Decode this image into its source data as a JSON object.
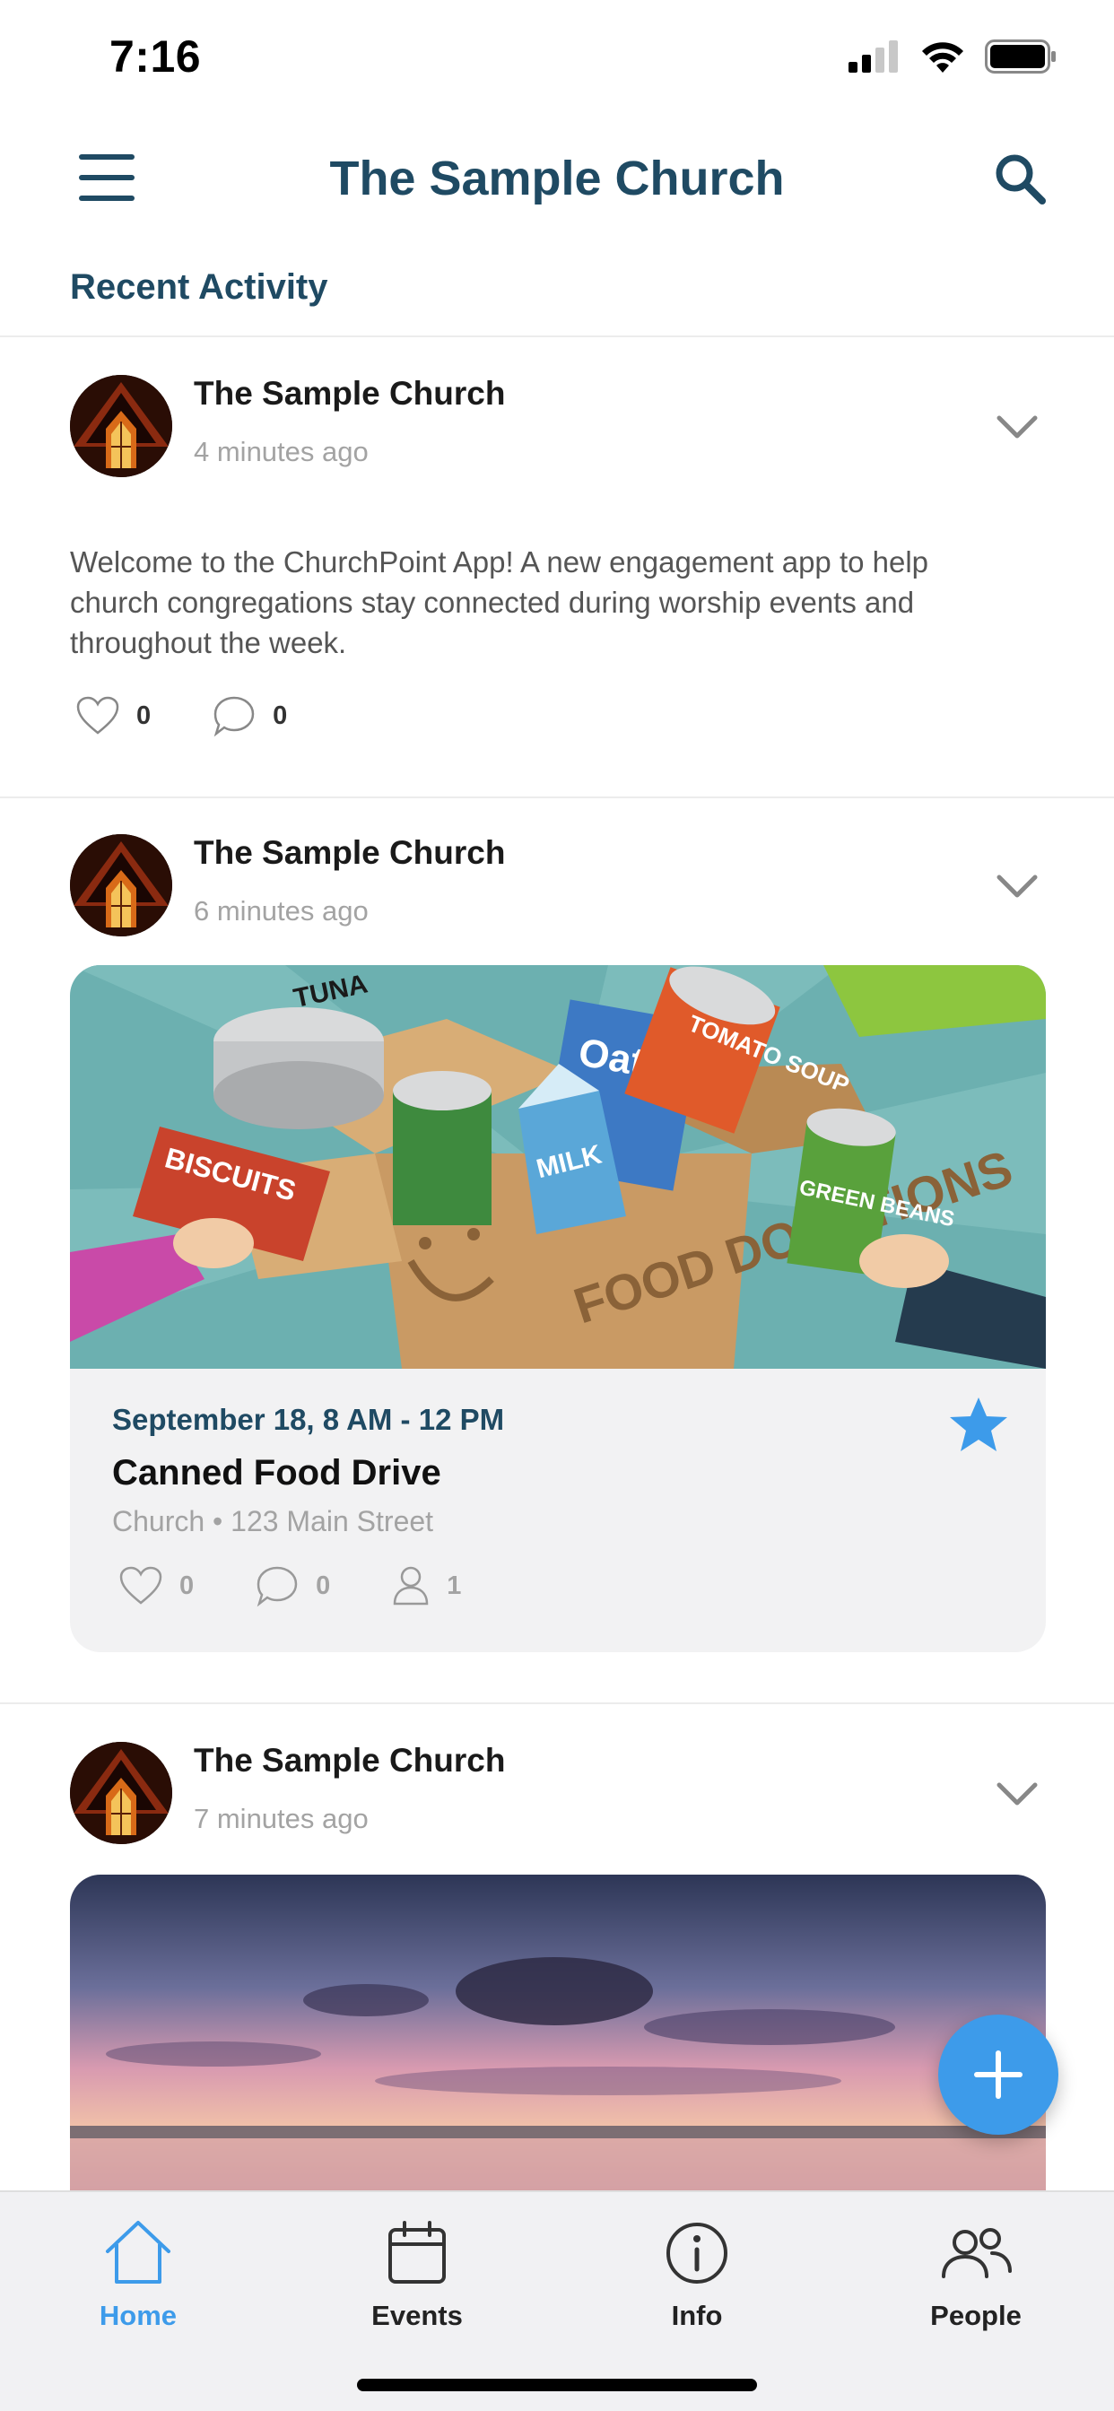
{
  "status_bar": {
    "time": "7:16"
  },
  "header": {
    "title": "The Sample Church"
  },
  "section": {
    "title": "Recent Activity"
  },
  "posts": [
    {
      "author": "The Sample Church",
      "time": "4 minutes ago",
      "text": "Welcome to  the ChurchPoint App!  A new engagement app to help church congregations stay connected during worship events and throughout the week.",
      "likes": "0",
      "comments": "0"
    },
    {
      "author": "The Sample Church",
      "time": "6 minutes ago",
      "event": {
        "date": "September 18, 8 AM - 12 PM",
        "title": "Canned Food Drive",
        "location": "Church • 123 Main Street",
        "likes": "0",
        "comments": "0",
        "attendees": "1",
        "starred": true,
        "image_text": {
          "tuna": "TUNA",
          "biscuits": "BISCUITS",
          "tomato": "TOMATO SOUP",
          "beans": "GREEN BEANS",
          "milk": "MILK",
          "oatmeal": "Oatmeal",
          "box": "FOOD DONATIONS"
        }
      }
    },
    {
      "author": "The Sample Church",
      "time": "7 minutes ago"
    }
  ],
  "tabs": [
    {
      "label": "Home",
      "icon": "home-icon",
      "active": true
    },
    {
      "label": "Events",
      "icon": "calendar-icon",
      "active": false
    },
    {
      "label": "Info",
      "icon": "info-icon",
      "active": false
    },
    {
      "label": "People",
      "icon": "people-icon",
      "active": false
    }
  ],
  "colors": {
    "accent": "#3d9bea",
    "brand": "#1f4a63",
    "muted": "#a3a3a3"
  }
}
